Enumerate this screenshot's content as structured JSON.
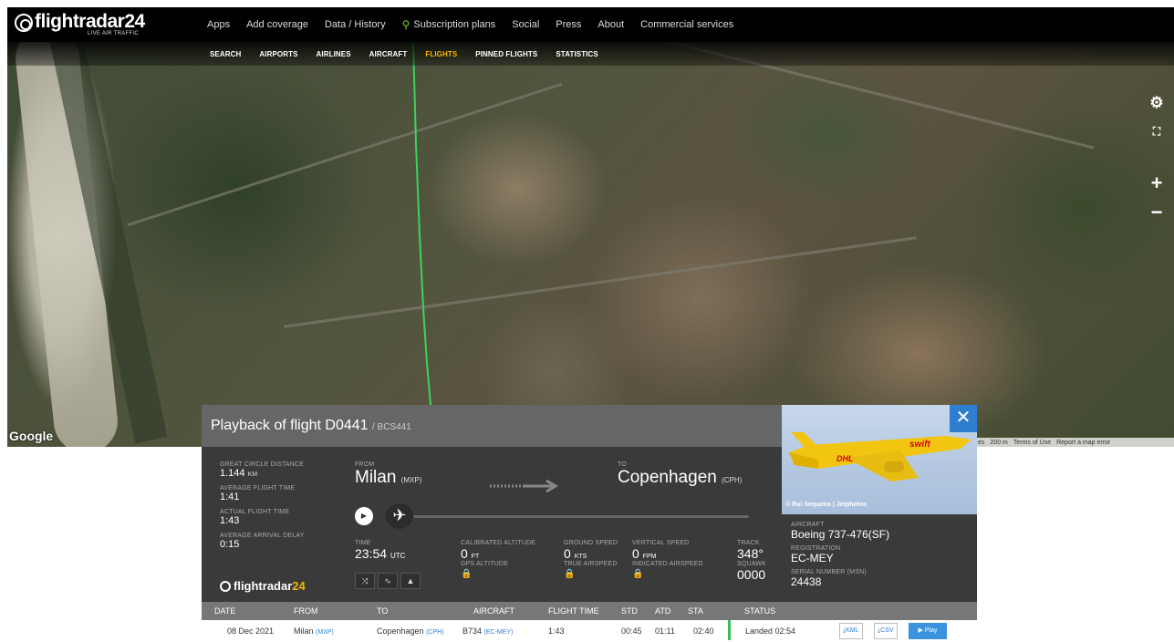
{
  "app": {
    "brand": "flightradar",
    "brand_num": "24",
    "tagline": "LIVE AIR TRAFFIC"
  },
  "nav": {
    "items": [
      "Apps",
      "Add coverage",
      "Data / History",
      "Subscription plans",
      "Social",
      "Press",
      "About",
      "Commercial services"
    ]
  },
  "subnav": {
    "items": [
      "SEARCH",
      "AIRPORTS",
      "AIRLINES",
      "AIRCRAFT",
      "FLIGHTS",
      "PINNED FLIGHTS",
      "STATISTICS"
    ],
    "active": "FLIGHTS"
  },
  "map": {
    "provider": "Google",
    "attribution": [
      "es",
      "200 m",
      "Terms of Use",
      "Report a map error"
    ],
    "controls": [
      "gear-icon",
      "fullscreen-icon",
      "zoom-in-icon",
      "zoom-out-icon"
    ],
    "track_color": "#3cd35f"
  },
  "panel": {
    "title": "Playback of flight D0441",
    "callsign": "/ BCS441",
    "stats": {
      "gcd_label": "GREAT CIRCLE DISTANCE",
      "gcd_value": "1.144",
      "gcd_unit": "KM",
      "avg_time_label": "AVERAGE FLIGHT TIME",
      "avg_time_value": "1:41",
      "actual_time_label": "ACTUAL FLIGHT TIME",
      "actual_time_value": "1:43",
      "avg_delay_label": "AVERAGE ARRIVAL DELAY",
      "avg_delay_value": "0:15"
    },
    "from_label": "FROM",
    "from_city": "Milan",
    "from_code": "(MXP)",
    "to_label": "TO",
    "to_city": "Copenhagen",
    "to_code": "(CPH)",
    "time_label": "TIME",
    "time_value": "23:54",
    "time_unit": "UTC",
    "cal_alt_label": "CALIBRATED ALTITUDE",
    "cal_alt_value": "0",
    "cal_alt_unit": "FT",
    "gps_alt_label": "GPS ALTITUDE",
    "ground_speed_label": "GROUND SPEED",
    "ground_speed_value": "0",
    "ground_speed_unit": "KTS",
    "true_airspeed_label": "TRUE AIRSPEED",
    "vert_speed_label": "VERTICAL SPEED",
    "vert_speed_value": "0",
    "vert_speed_unit": "FPM",
    "ind_airspeed_label": "INDICATED AIRSPEED",
    "track_label": "TRACK",
    "track_value": "348°",
    "squawk_label": "SQUAWK",
    "squawk_value": "0000",
    "fr_logo": "flightradar",
    "fr_logo_num": "24"
  },
  "aircraft": {
    "photo_credit": "© Rui Sequeira | Jetphotos",
    "aircraft_label": "AIRCRAFT",
    "aircraft_value": "Boeing 737-476(SF)",
    "registration_label": "REGISTRATION",
    "registration_value": "EC-MEY",
    "serial_label": "SERIAL NUMBER (MSN)",
    "serial_value": "24438",
    "livery_text": "swift",
    "livery_brand": "DHL"
  },
  "table": {
    "headers": [
      "DATE",
      "FROM",
      "TO",
      "AIRCRAFT",
      "FLIGHT TIME",
      "STD",
      "ATD",
      "STA",
      "STATUS"
    ],
    "row": {
      "date": "08 Dec 2021",
      "from": "Milan",
      "from_code": "(MXP)",
      "to": "Copenhagen",
      "to_code": "(CPH)",
      "aircraft": "B734",
      "aircraft_reg": "(EC-MEY)",
      "flight_time": "1:43",
      "std": "00:45",
      "atd": "01:11",
      "sta": "02:40",
      "status": "Landed 02:54",
      "kml": "KML",
      "csv": "CSV",
      "play": "Play"
    }
  }
}
